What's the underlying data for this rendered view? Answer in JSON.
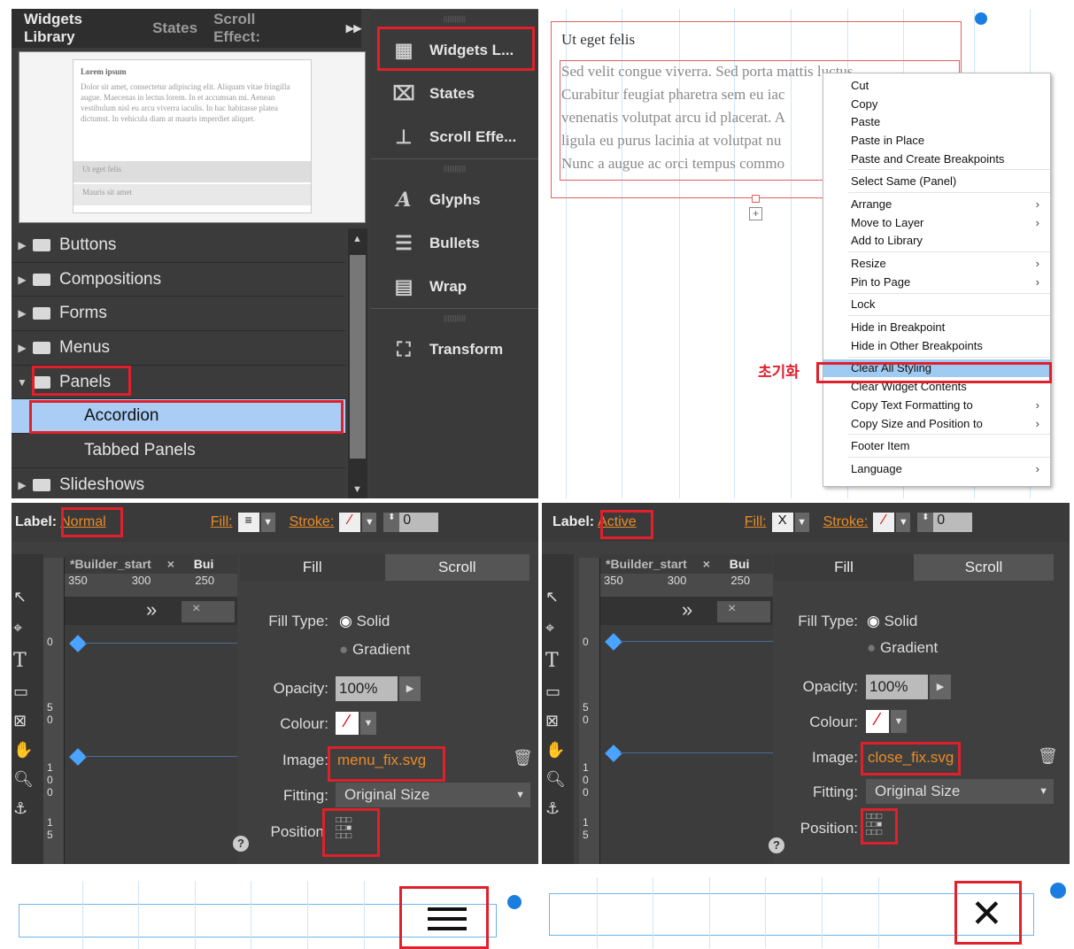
{
  "q1": {
    "tabs": [
      "Widgets Library",
      "States",
      "Scroll Effect:"
    ],
    "preview": {
      "title": "Lorem ipsum",
      "body": "Dolor sit amet, consectetur adipiscing elit. Aliquam vitae fringilla augue. Maecenas in lectus lorem. In et accumsan mi. Aenean vestibulum nisl eu arcu viverra iaculis. In hac habitasse platea dictumst. In vehicula diam at mauris imperdiet aliquet.",
      "item1": "Ut eget felis",
      "item2": "Mauris sit amet"
    },
    "tree": [
      "Buttons",
      "Compositions",
      "Forms",
      "Menus",
      "Panels",
      "Accordion",
      "Tabbed Panels",
      "Slideshows"
    ],
    "tools": [
      "Widgets L...",
      "States",
      "Scroll Effe...",
      "Glyphs",
      "Bullets",
      "Wrap",
      "Transform"
    ]
  },
  "q2": {
    "heading": "Ut eget felis",
    "lines": [
      "Sed velit congue viverra. Sed porta mattis luctus",
      "Curabitur feugiat pharetra sem eu iac",
      "venenatis volutpat arcu id placerat. A",
      "ligula eu purus lacinia at volutpat nu",
      "Nunc a augue ac orci tempus commo"
    ],
    "menu": [
      "Cut",
      "Copy",
      "Paste",
      "Paste in Place",
      "Paste and Create Breakpoints",
      "Select Same (Panel)",
      "Arrange",
      "Move to Layer",
      "Add to Library",
      "Resize",
      "Pin to Page",
      "Lock",
      "Hide in Breakpoint",
      "Hide in Other Breakpoints",
      "Clear All Styling",
      "Clear Widget Contents",
      "Copy Text Formatting to",
      "Copy Size and Position to",
      "Footer Item",
      "Language"
    ],
    "annotation": "초기화"
  },
  "q3": {
    "label": "Label:",
    "label_value": "Normal",
    "fill": "Fill:",
    "stroke": "Stroke:",
    "stroke_val": "0",
    "doc_tab": "*Builder_start",
    "doc_tab2": "Bui",
    "ruler": [
      "350",
      "300",
      "250"
    ],
    "ftab1": "Fill",
    "ftab2": "Scroll",
    "filltype": "Fill Type:",
    "solid": "Solid",
    "gradient": "Gradient",
    "opacity": "Opacity:",
    "opacity_val": "100%",
    "colour": "Colour:",
    "image": "Image:",
    "image_val": "menu_fix.svg",
    "fitting": "Fitting:",
    "fitting_val": "Original Size",
    "position": "Position"
  },
  "q4": {
    "label": "Label:",
    "label_value": "Active",
    "fill": "Fill:",
    "stroke": "Stroke:",
    "stroke_val": "0",
    "doc_tab": "*Builder_start",
    "doc_tab2": "Bui",
    "ruler": [
      "350",
      "300",
      "250"
    ],
    "ftab1": "Fill",
    "ftab2": "Scroll",
    "filltype": "Fill Type:",
    "solid": "Solid",
    "gradient": "Gradient",
    "opacity": "Opacity:",
    "opacity_val": "100%",
    "colour": "Colour:",
    "image": "Image:",
    "image_val": "close_fix.svg",
    "fitting": "Fitting:",
    "fitting_val": "Original Size",
    "position": "Position:"
  }
}
